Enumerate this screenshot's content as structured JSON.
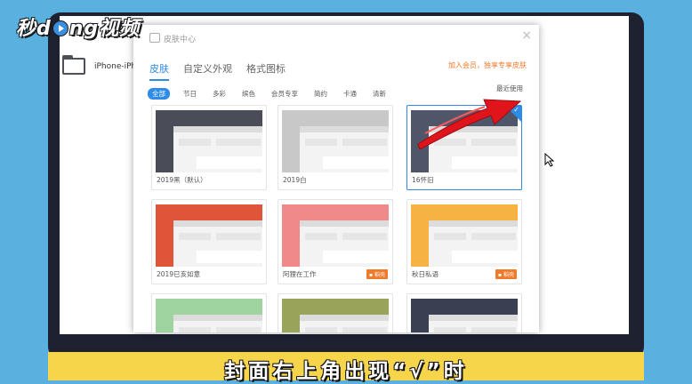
{
  "logo": {
    "text_left": "秒d",
    "text_right": "ng视频"
  },
  "desktop": {
    "folder_label": "iPhone-iPho"
  },
  "dialog": {
    "title": "皮肤中心",
    "close_symbol": "×",
    "tabs": [
      {
        "label": "皮肤",
        "active": true
      },
      {
        "label": "自定义外观",
        "active": false
      },
      {
        "label": "格式图标",
        "active": false
      }
    ],
    "vip_link": "加入会员，独享专享皮肤",
    "filters": [
      {
        "label": "全部",
        "active": true
      },
      {
        "label": "节日",
        "active": false
      },
      {
        "label": "多彩",
        "active": false
      },
      {
        "label": "缤色",
        "active": false
      },
      {
        "label": "会员专享",
        "active": false
      },
      {
        "label": "简约",
        "active": false
      },
      {
        "label": "卡通",
        "active": false
      },
      {
        "label": "清新",
        "active": false
      }
    ],
    "recent_label": "最近使用",
    "skins": [
      {
        "caption": "2019黑（默认）",
        "badge": "",
        "selected": false,
        "theme": "dark",
        "accent": "#4a4d57"
      },
      {
        "caption": "2019白",
        "badge": "",
        "selected": false,
        "theme": "light",
        "accent": "#c8c8c8"
      },
      {
        "caption": "16怀旧",
        "badge": "",
        "selected": true,
        "theme": "retro",
        "accent": "#50566a"
      },
      {
        "caption": "2019已亥如意",
        "badge": "",
        "selected": false,
        "theme": "red",
        "accent": "#e0553a"
      },
      {
        "caption": "阿狸在工作",
        "badge": "▪ 稻壳",
        "selected": false,
        "theme": "pink",
        "accent": "#f08a8a"
      },
      {
        "caption": "秋日私语",
        "badge": "▪ 稻壳",
        "selected": false,
        "theme": "orange",
        "accent": "#f6b342"
      },
      {
        "caption": "",
        "badge": "",
        "selected": false,
        "theme": "green",
        "accent": "#9fd4a0"
      },
      {
        "caption": "",
        "badge": "",
        "selected": false,
        "theme": "olive",
        "accent": "#9aa35a"
      },
      {
        "caption": "",
        "badge": "",
        "selected": false,
        "theme": "night",
        "accent": "#3a3f52"
      }
    ]
  },
  "subtitle": "封面右上角出现“√”时",
  "colors": {
    "accent": "#2e8be6",
    "vip": "#f07a2a",
    "caption_bar": "#f7d54a",
    "background": "#5ab0df"
  }
}
